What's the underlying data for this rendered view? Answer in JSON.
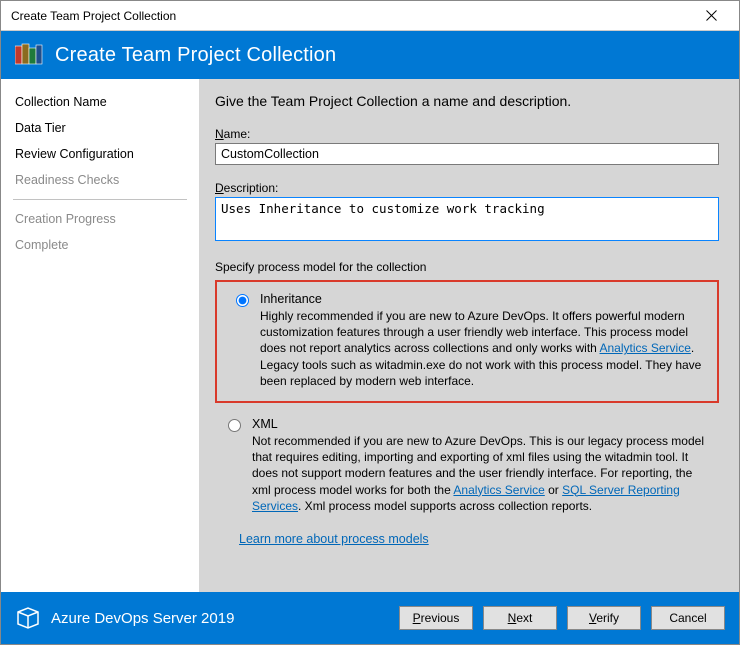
{
  "window": {
    "title": "Create Team Project Collection",
    "close_icon": "close"
  },
  "banner": {
    "heading": "Create Team Project Collection"
  },
  "sidebar": {
    "steps": [
      {
        "label": "Collection Name",
        "state": "active"
      },
      {
        "label": "Data Tier",
        "state": "normal"
      },
      {
        "label": "Review Configuration",
        "state": "normal"
      },
      {
        "label": "Readiness Checks",
        "state": "disabled"
      }
    ],
    "steps2": [
      {
        "label": "Creation Progress",
        "state": "disabled"
      },
      {
        "label": "Complete",
        "state": "disabled"
      }
    ]
  },
  "main": {
    "intro": "Give the Team Project Collection a name and description.",
    "name_label_pre": "N",
    "name_label_rest": "ame:",
    "name_value": "CustomCollection",
    "desc_label_pre": "D",
    "desc_label_rest": "escription:",
    "desc_value": "Uses Inheritance to customize work tracking",
    "process_section_label": "Specify process model for the collection",
    "radio_inheritance": {
      "label": "Inheritance",
      "desc_pre": "Highly recommended if you are new to Azure DevOps. It offers powerful modern customization features through a user friendly web interface. This process model does not report analytics across collections and only works with ",
      "link1": "Analytics Service",
      "desc_post": ". Legacy tools such as witadmin.exe do not work with this process model. They have been replaced by modern web interface."
    },
    "radio_xml": {
      "label": "XML",
      "desc_pre": "Not recommended if you are new to Azure DevOps. This is our legacy process model that requires editing, importing and exporting of xml files using the witadmin tool. It does not support modern features and the user friendly interface. For reporting, the xml process model works for both the ",
      "link1": "Analytics Service",
      "mid": " or ",
      "link2": "SQL Server Reporting Services",
      "desc_post": ". Xml process model supports across collection reports."
    },
    "learn_more": "Learn more about process models"
  },
  "footer": {
    "brand": "Azure DevOps Server 2019",
    "previous_pre": "P",
    "previous_rest": "revious",
    "next_pre": "N",
    "next_rest": "ext",
    "verify_pre": "V",
    "verify_rest": "erify",
    "cancel": "Cancel"
  }
}
